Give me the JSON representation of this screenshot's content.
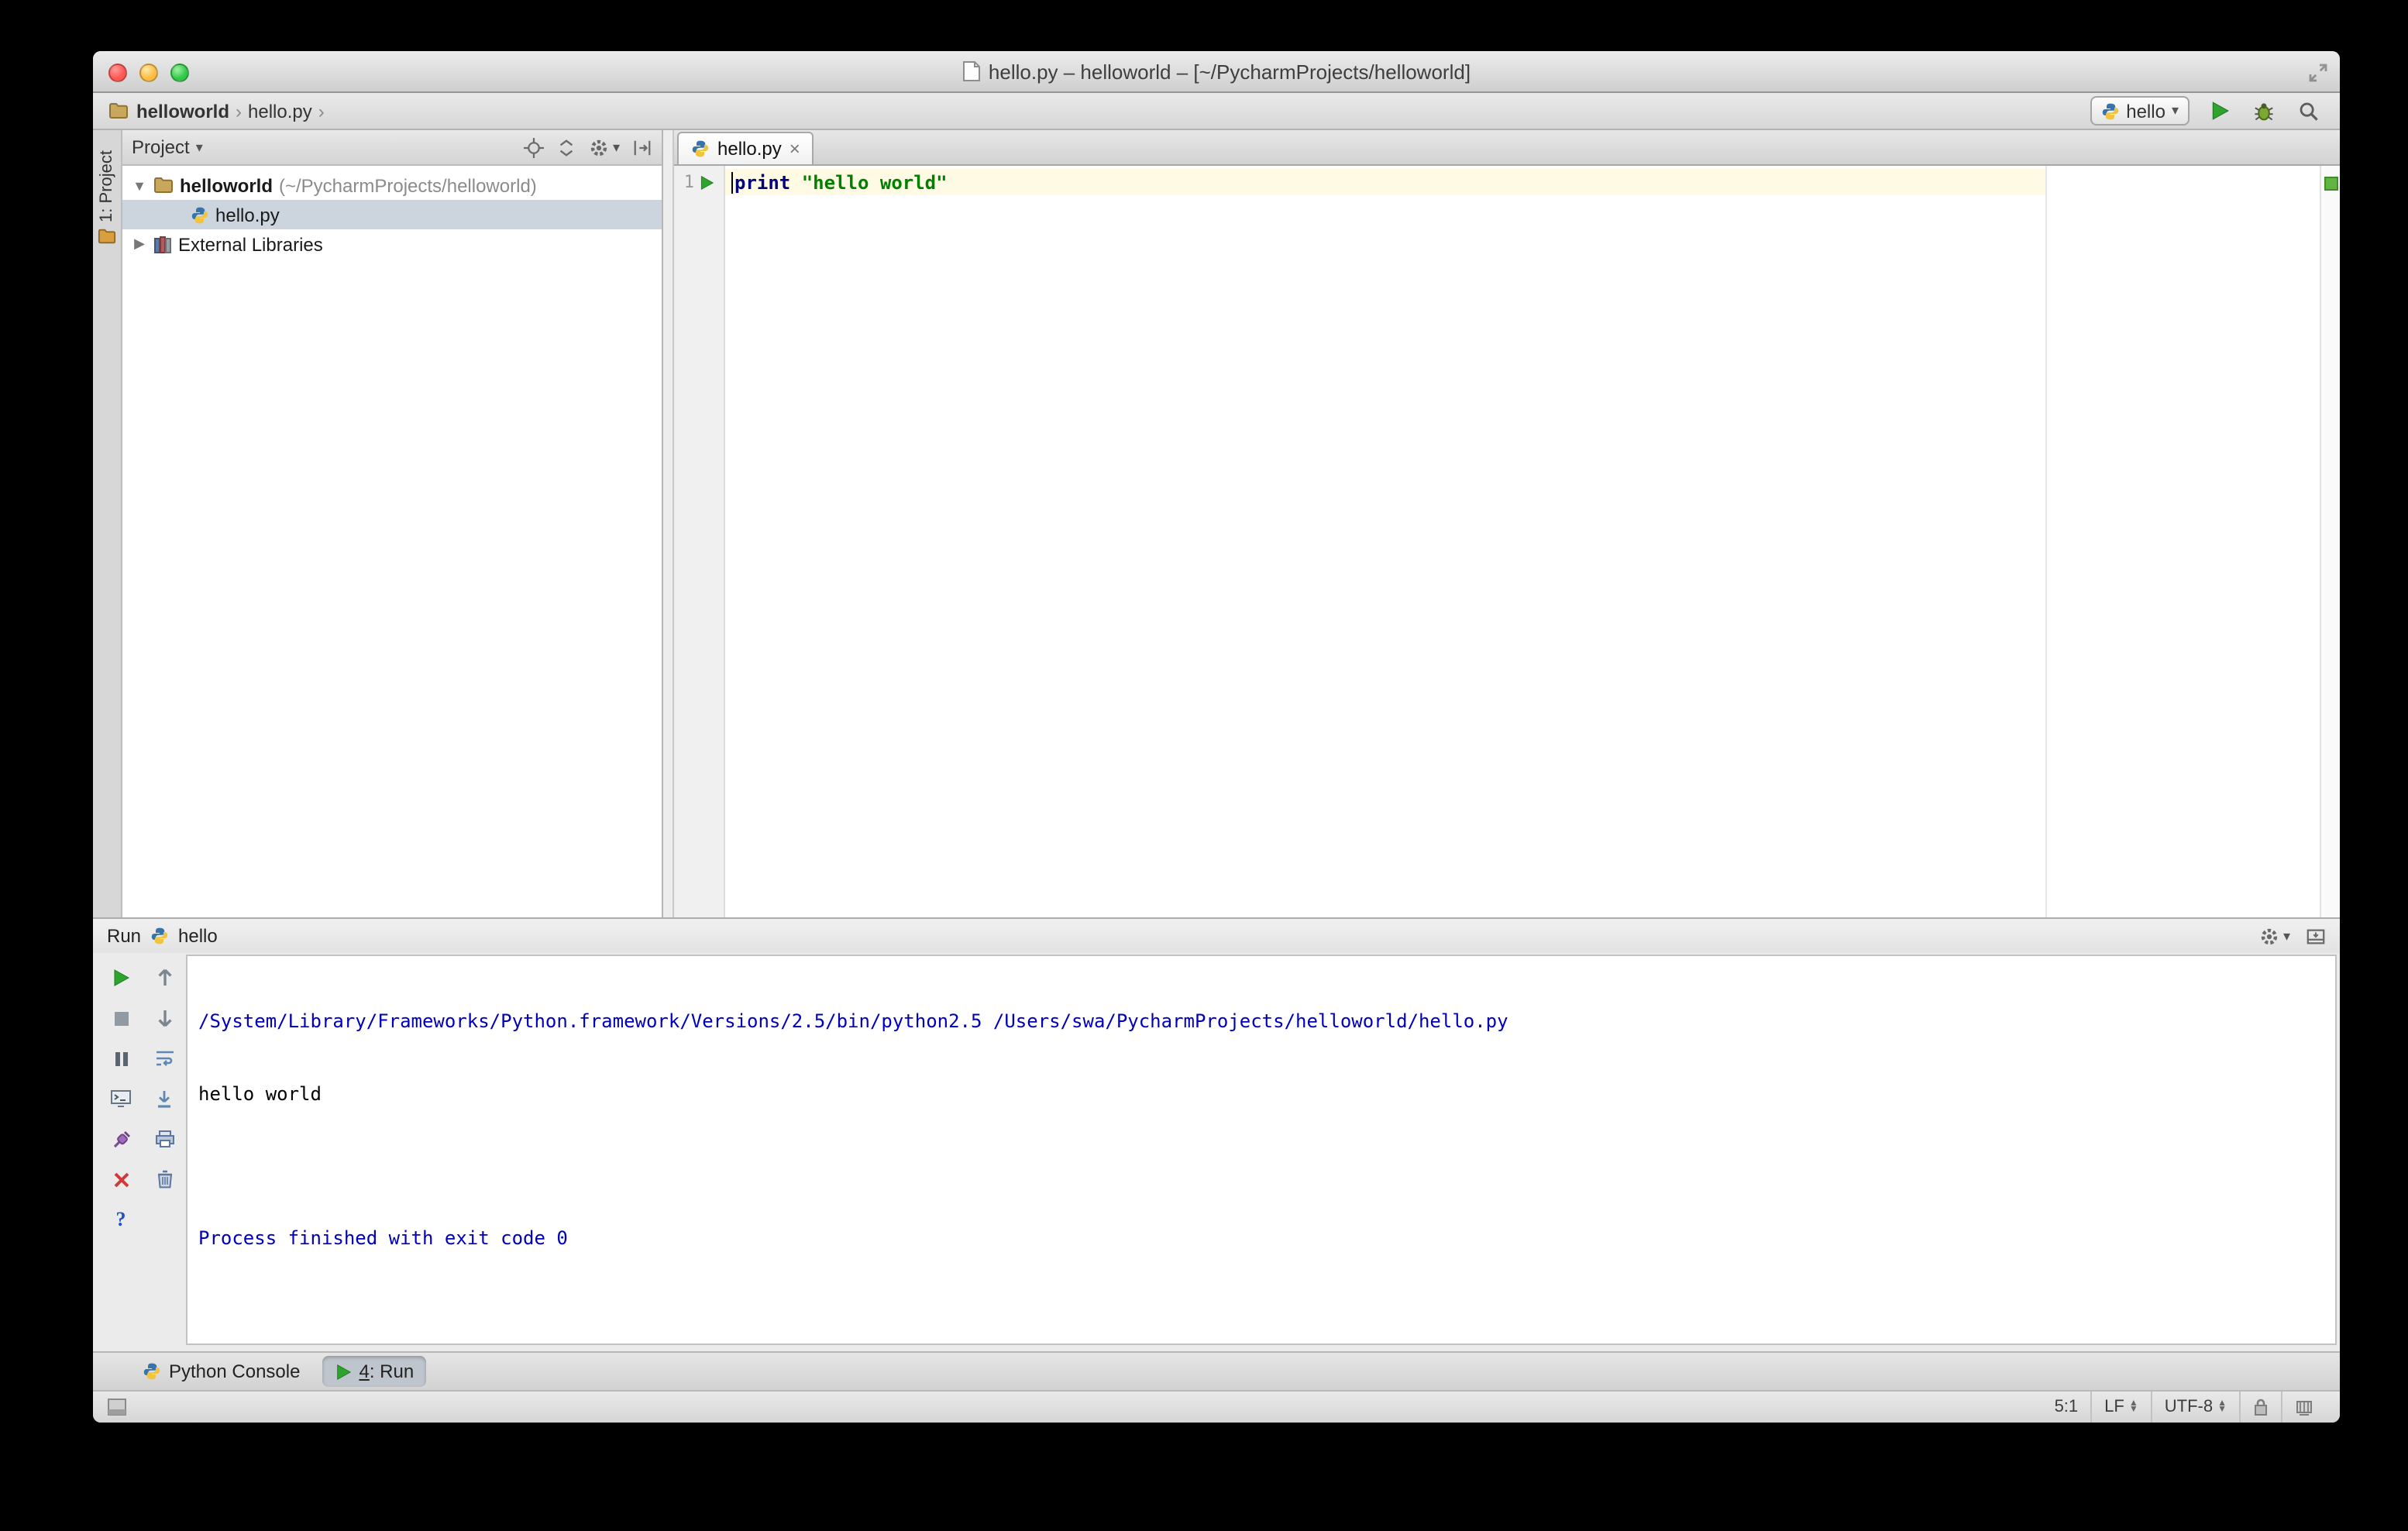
{
  "titlebar": {
    "title": "hello.py – helloworld – [~/PycharmProjects/helloworld]"
  },
  "navbar": {
    "breadcrumb": {
      "project": "helloworld",
      "separator": "›",
      "file": "hello.py"
    },
    "run_config": "hello"
  },
  "stripe": {
    "project_button": "1: Project"
  },
  "project_panel": {
    "header": "Project",
    "root_name": "helloworld",
    "root_path": "(~/PycharmProjects/helloworld)",
    "file": "hello.py",
    "external_libraries": "External Libraries"
  },
  "editor": {
    "tab": "hello.py",
    "close": "×",
    "line_number": "1",
    "keyword": "print",
    "string": "\"hello world\""
  },
  "run_panel": {
    "title": "Run",
    "config": "hello",
    "lines": [
      {
        "text": "/System/Library/Frameworks/Python.framework/Versions/2.5/bin/python2.5 /Users/swa/PycharmProjects/helloworld/hello.py",
        "type": "system"
      },
      {
        "text": "hello world",
        "type": "stdout"
      },
      {
        "text": "",
        "type": "stdout"
      },
      {
        "text": "Process finished with exit code 0",
        "type": "system"
      }
    ]
  },
  "bottom_bar": {
    "python_console": "Python Console",
    "run_mnemonic": "4",
    "run_rest": ": Run"
  },
  "status_bar": {
    "caret": "5:1",
    "line_sep": "LF",
    "encoding": "UTF-8"
  }
}
